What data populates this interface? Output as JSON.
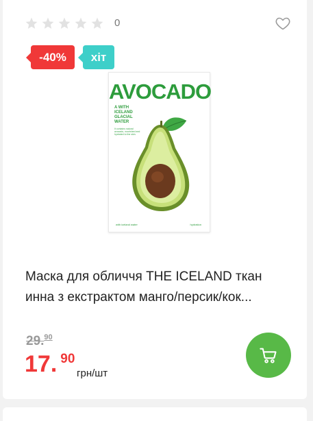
{
  "rating": {
    "stars_filled": 0,
    "stars_total": 5,
    "count": "0"
  },
  "badges": {
    "discount": "-40%",
    "hit": "хіт"
  },
  "package": {
    "brand": "AVOCADO",
    "side_text": "A WITH ICELAND GLACIAL WATER",
    "desc_text": "It contains natural avocado, nourished and hydrated to the skin.",
    "foot_left": "with iceland water",
    "foot_right": "hydration"
  },
  "product": {
    "title_line1": "Маска для обличчя THE ICELAND ткан",
    "title_line2": "инна з екстрактом манго/персик/кок..."
  },
  "price": {
    "old_main": "29.",
    "old_cents": "90",
    "new_main": "17.",
    "new_cents": "90",
    "unit": "грн/шт"
  },
  "colors": {
    "discount_badge": "#f03838",
    "hit_badge": "#3ecfc9",
    "cart_button": "#58b947",
    "price_new": "#f03838",
    "star_empty": "#e2e2e2"
  },
  "icons": {
    "favorite": "heart-outline-icon",
    "cart": "shopping-cart-icon",
    "star": "star-icon"
  }
}
